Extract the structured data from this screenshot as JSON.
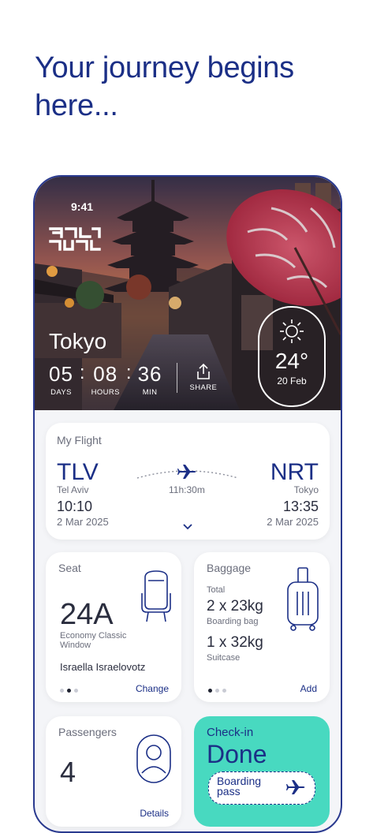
{
  "headline": "Your journey begins here...",
  "status": {
    "time": "9:41"
  },
  "brand": {
    "logo_text": "ELAL"
  },
  "destination": {
    "city": "Tokyo",
    "countdown": [
      {
        "value": "05",
        "label": "DAYS"
      },
      {
        "value": "08",
        "label": "HOURS"
      },
      {
        "value": "36",
        "label": "MIN"
      }
    ],
    "share_label": "SHARE",
    "weather": {
      "temp": "24°",
      "date": "20 Feb",
      "icon": "sun-icon"
    }
  },
  "flight": {
    "title": "My Flight",
    "origin": {
      "code": "TLV",
      "city": "Tel Aviv",
      "time": "10:10",
      "date": "2 Mar 2025"
    },
    "destination": {
      "code": "NRT",
      "city": "Tokyo",
      "time": "13:35",
      "date": "2 Mar 2025"
    },
    "duration": "11h:30m"
  },
  "seat": {
    "title": "Seat",
    "number": "24A",
    "class_line1": "Economy Classic",
    "class_line2": "Window",
    "passenger": "Israella Israelovotz",
    "action": "Change",
    "page_dots": {
      "count": 3,
      "active": 2
    }
  },
  "baggage": {
    "title": "Baggage",
    "total_label": "Total",
    "item1_value": "2 x 23kg",
    "item1_label": "Boarding bag",
    "item2_value": "1 x 32kg",
    "item2_label": "Suitcase",
    "action": "Add",
    "page_dots": {
      "count": 3,
      "active": 1
    }
  },
  "passengers": {
    "title": "Passengers",
    "count": "4",
    "action": "Details"
  },
  "checkin": {
    "title": "Check-in",
    "status": "Done",
    "boarding_pass": "Boarding pass"
  },
  "colors": {
    "brand_blue": "#1b2f86",
    "checkin_green": "#48d9c0"
  }
}
